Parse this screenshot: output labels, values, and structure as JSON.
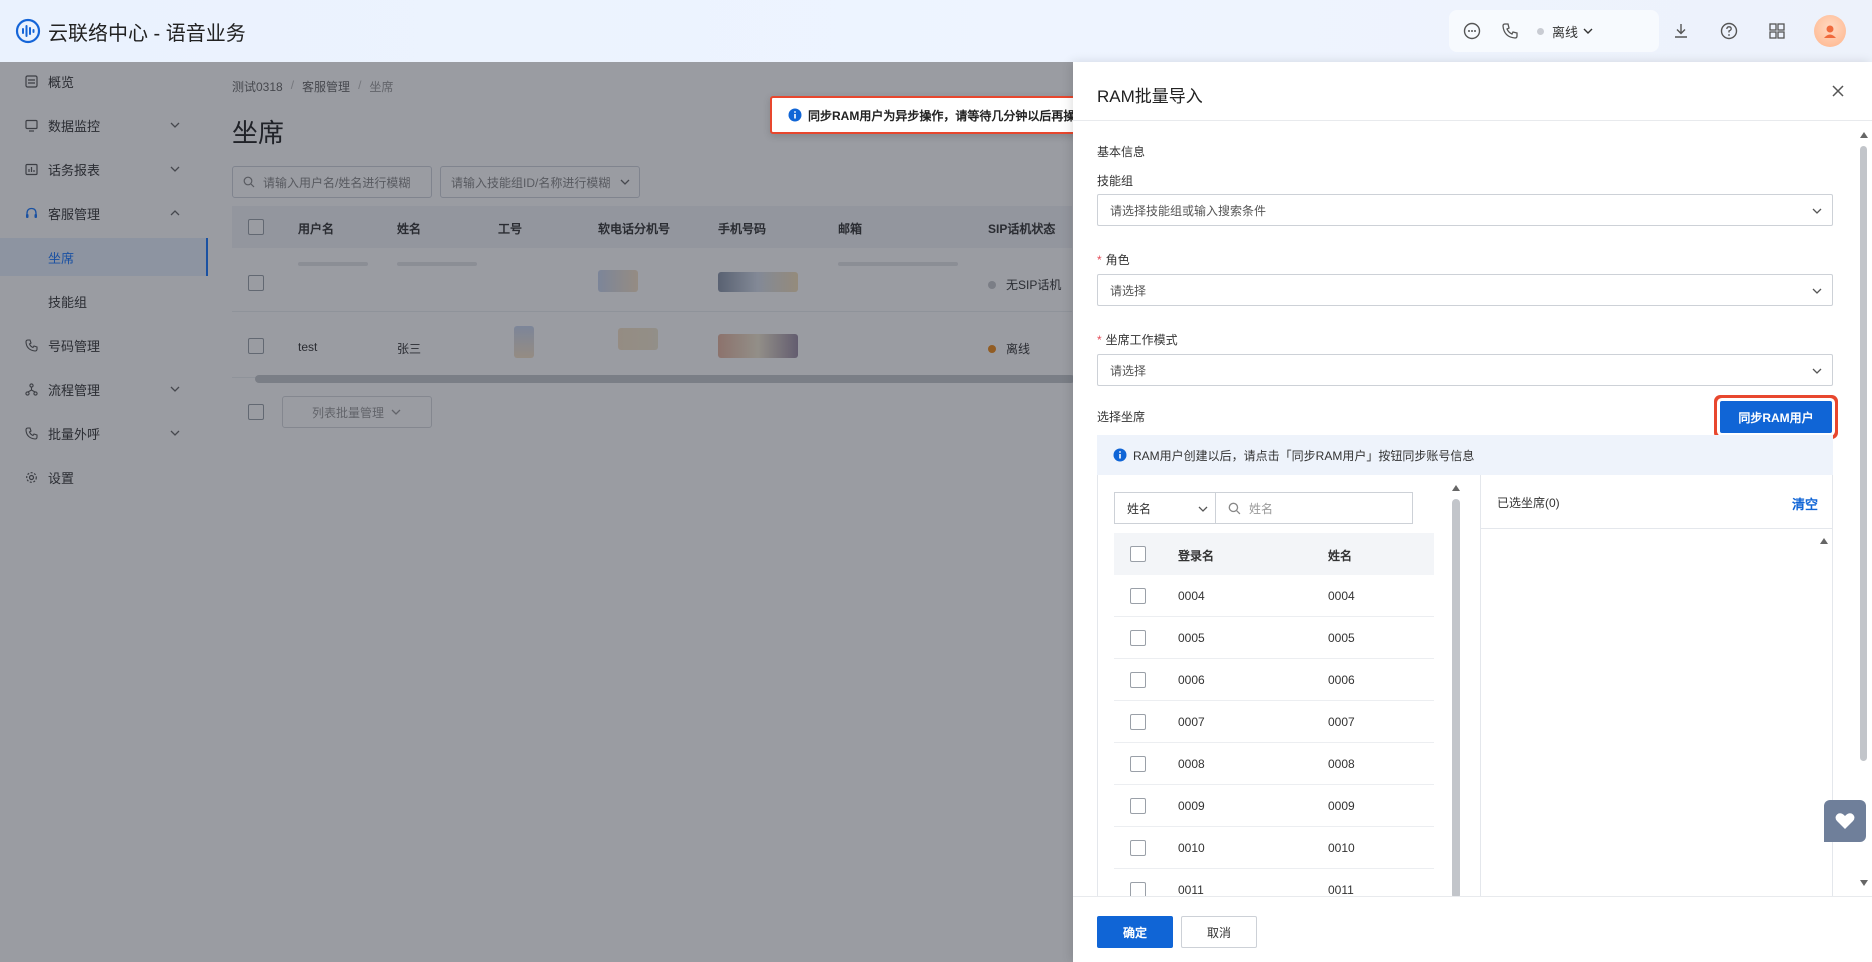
{
  "header": {
    "app_title": "云联络中心 - 语音业务",
    "status_label": "离线"
  },
  "sidebar": {
    "items": [
      {
        "label": "概览",
        "icon": "overview-icon"
      },
      {
        "label": "数据监控",
        "icon": "monitor-icon"
      },
      {
        "label": "话务报表",
        "icon": "report-icon"
      },
      {
        "label": "客服管理",
        "icon": "headset-icon"
      },
      {
        "label": "坐席",
        "active": true
      },
      {
        "label": "技能组"
      },
      {
        "label": "号码管理",
        "icon": "phone-icon"
      },
      {
        "label": "流程管理",
        "icon": "flow-icon"
      },
      {
        "label": "批量外呼",
        "icon": "call-out-icon"
      },
      {
        "label": "设置",
        "icon": "gear-icon"
      }
    ]
  },
  "main": {
    "breadcrumb": [
      "测试0318",
      "客服管理",
      "坐席"
    ],
    "page_title": "坐席",
    "filter_user_placeholder": "请输入用户名/姓名进行模糊",
    "filter_skill_placeholder": "请输入技能组ID/名称进行模糊",
    "table": {
      "columns": [
        "用户名",
        "姓名",
        "工号",
        "软电话分机号",
        "手机号码",
        "邮箱",
        "SIP话机状态"
      ],
      "rows": [
        {
          "username": "",
          "name": "",
          "sip_status": "无SIP话机",
          "sip_color": "#c7c9cd"
        },
        {
          "username": "test",
          "name": "张三",
          "sip_status": "离线",
          "sip_color": "#f08c1a"
        }
      ]
    },
    "batch_manage_label": "列表批量管理"
  },
  "toast": {
    "message": "同步RAM用户为异步操作，请等待几分钟以后再操作"
  },
  "drawer": {
    "title": "RAM批量导入",
    "section_basic": "基本信息",
    "skill_group_label": "技能组",
    "skill_group_placeholder": "请选择技能组或输入搜索条件",
    "role_label": "角色",
    "role_placeholder": "请选择",
    "work_mode_label": "坐席工作模式",
    "work_mode_placeholder": "请选择",
    "select_agent_label": "选择坐席",
    "sync_button": "同步RAM用户",
    "info_text": "RAM用户创建以后，请点击「同步RAM用户」按钮同步账号信息",
    "transfer": {
      "filter_field": "姓名",
      "search_placeholder": "姓名",
      "col_login": "登录名",
      "col_name": "姓名",
      "rows": [
        {
          "login": "0004",
          "name": "0004"
        },
        {
          "login": "0005",
          "name": "0005"
        },
        {
          "login": "0006",
          "name": "0006"
        },
        {
          "login": "0007",
          "name": "0007"
        },
        {
          "login": "0008",
          "name": "0008"
        },
        {
          "login": "0009",
          "name": "0009"
        },
        {
          "login": "0010",
          "name": "0010"
        },
        {
          "login": "0011",
          "name": "0011"
        }
      ],
      "selected_title": "已选坐席(0)",
      "clear_label": "清空"
    },
    "ok_button": "确定",
    "cancel_button": "取消"
  },
  "colors": {
    "primary": "#1065d6",
    "highlight": "#e8472e"
  }
}
